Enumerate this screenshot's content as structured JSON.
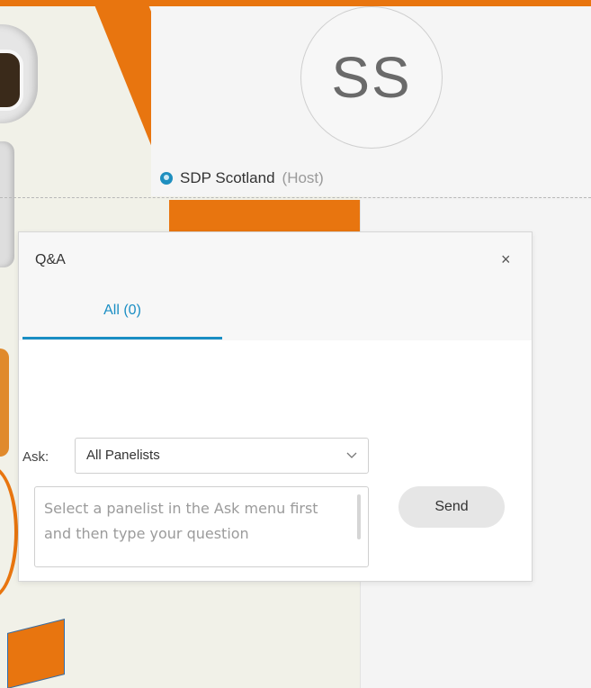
{
  "colors": {
    "accent": "#e8750f",
    "tab_active": "#1a8ec4",
    "status_dot": "#1f8fbf"
  },
  "video_tile": {
    "avatar_initials": "SS",
    "participant_name": "SDP Scotland",
    "participant_role": "(Host)",
    "status_icon": "status-dot-icon"
  },
  "qa_panel": {
    "title": "Q&A",
    "close_glyph": "×",
    "tabs": [
      {
        "label": "All (0)",
        "active": true
      }
    ],
    "ask_label": "Ask:",
    "ask_selected": "All Panelists",
    "question_placeholder": "Select a panelist in the Ask menu first and then type your question",
    "send_label": "Send"
  }
}
